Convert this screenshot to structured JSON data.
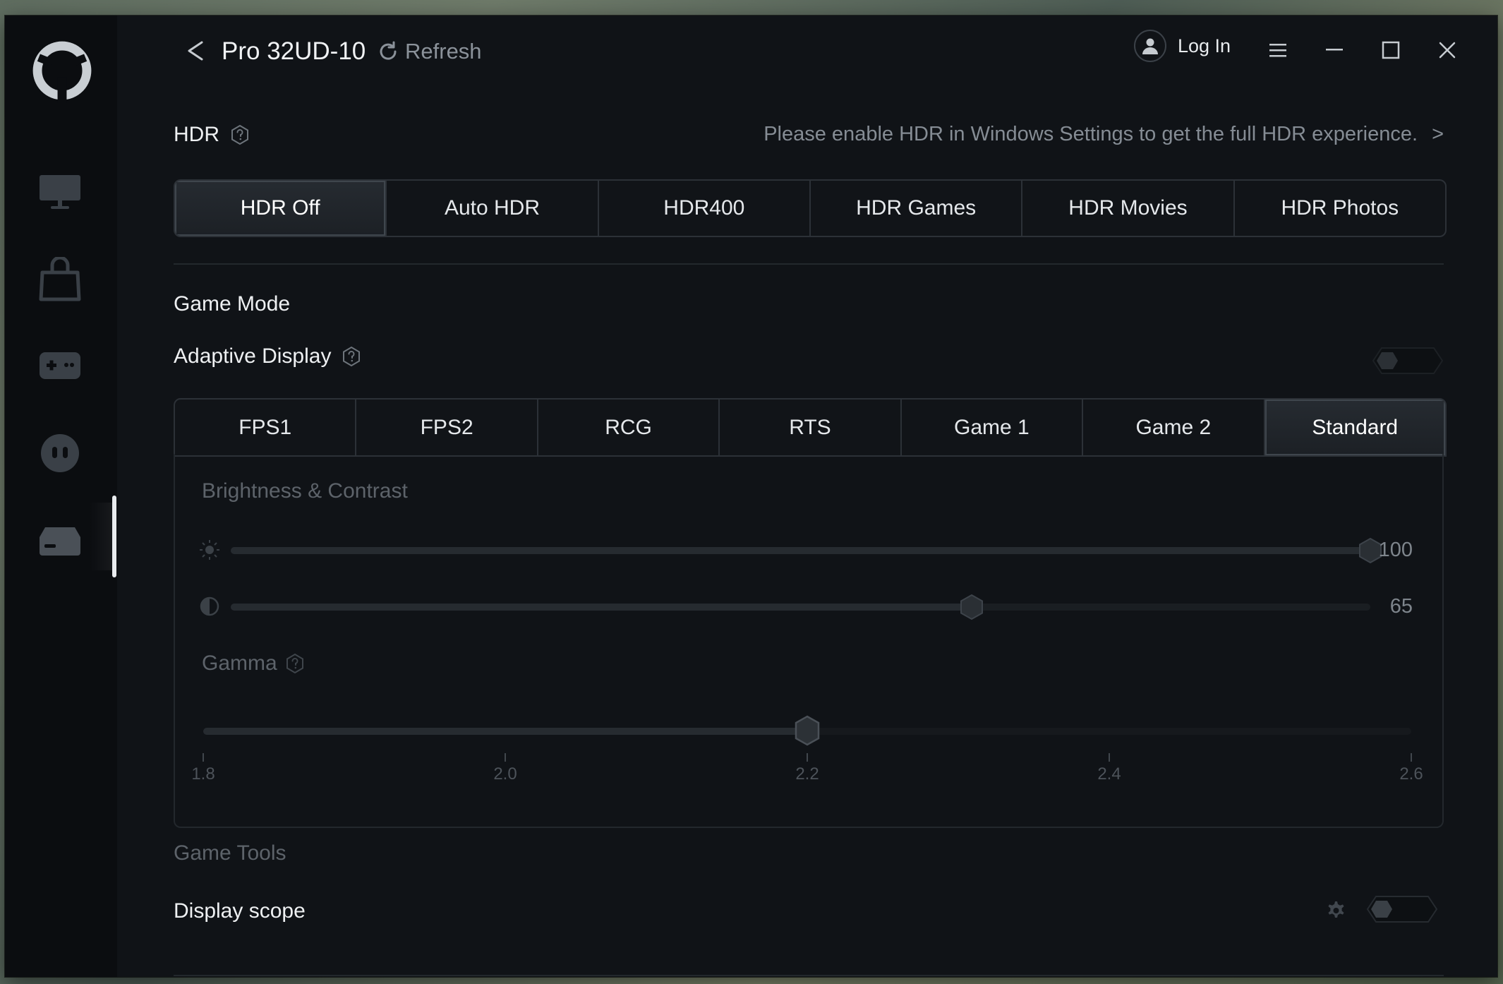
{
  "titlebar": {
    "device_name": "Pro 32UD-10",
    "refresh_label": "Refresh",
    "login_label": "Log In"
  },
  "sidebar": {
    "items": [
      {
        "icon": "monitor-icon",
        "active": false
      },
      {
        "icon": "shopping-bag-icon",
        "active": false
      },
      {
        "icon": "gamepad-icon",
        "active": false
      },
      {
        "icon": "face-icon",
        "active": false
      },
      {
        "icon": "device-icon",
        "active": true
      }
    ]
  },
  "hdr": {
    "label": "HDR",
    "notice": "Please enable HDR in Windows Settings to get the full HDR experience.",
    "notice_arrow": ">",
    "options": [
      "HDR Off",
      "Auto HDR",
      "HDR400",
      "HDR Games",
      "HDR Movies",
      "HDR Photos"
    ],
    "selected": "HDR Off"
  },
  "game_mode": {
    "title": "Game Mode",
    "adaptive_display_label": "Adaptive Display",
    "adaptive_display_on": false,
    "modes": [
      "FPS1",
      "FPS2",
      "RCG",
      "RTS",
      "Game 1",
      "Game 2",
      "Standard"
    ],
    "selected": "Standard",
    "brightness_contrast_title": "Brightness & Contrast",
    "brightness_value": "100",
    "contrast_value": "65",
    "brightness_level": 100,
    "contrast_level": 65,
    "gamma_label": "Gamma",
    "gamma_value": 2.2,
    "gamma_range": [
      1.8,
      2.6
    ],
    "gamma_ticks": [
      "1.8",
      "2.0",
      "2.2",
      "2.4",
      "2.6"
    ]
  },
  "game_tools": {
    "title": "Game Tools",
    "display_scope_label": "Display scope",
    "display_scope_on": false
  },
  "colors": {
    "background": "#101317",
    "sidebar": "#0b0d10",
    "text_primary": "#eef0f2",
    "text_muted": "#5d636a",
    "border": "#2c3137"
  }
}
